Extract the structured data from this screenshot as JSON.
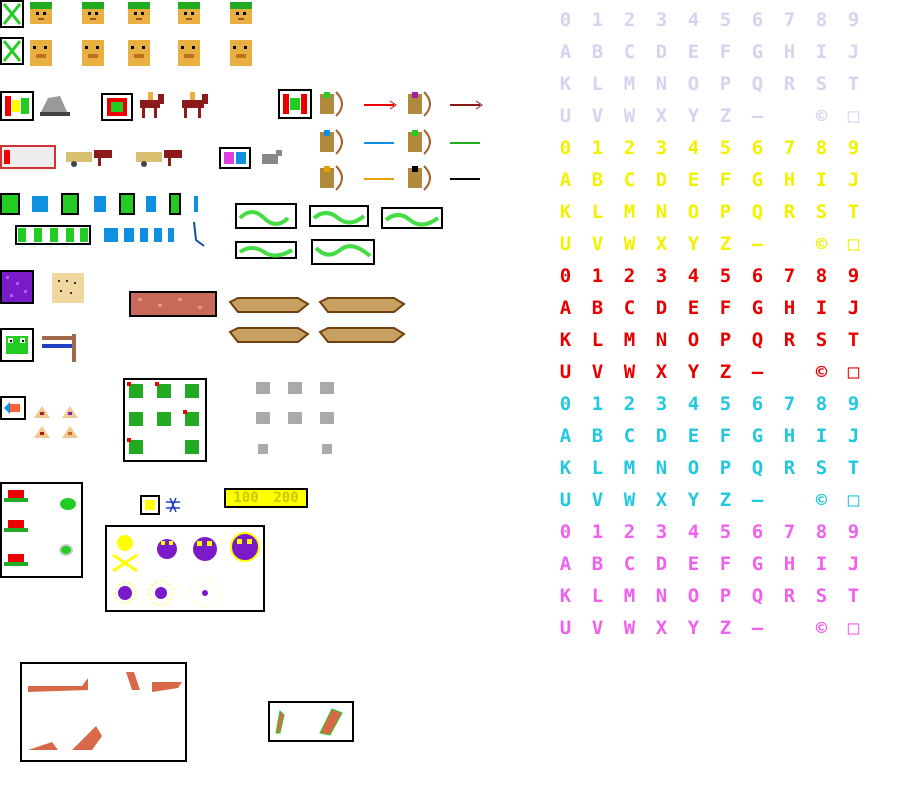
{
  "sheet": {
    "score_labels": [
      "100",
      "200"
    ],
    "score_colors": {
      "fill": "#ffff00",
      "text": "#c8c800"
    }
  },
  "font_table": {
    "rows": [
      [
        "0",
        "1",
        "2",
        "3",
        "4",
        "5",
        "6",
        "7",
        "8",
        "9"
      ],
      [
        "A",
        "B",
        "C",
        "D",
        "E",
        "F",
        "G",
        "H",
        "I",
        "J"
      ],
      [
        "K",
        "L",
        "M",
        "N",
        "O",
        "P",
        "Q",
        "R",
        "S",
        "T"
      ],
      [
        "U",
        "V",
        "W",
        "X",
        "Y",
        "Z",
        "—",
        "",
        "©",
        "□"
      ]
    ],
    "palettes": [
      {
        "name": "lavender",
        "color": "#d4d4f0"
      },
      {
        "name": "yellow",
        "color": "#f2f200"
      },
      {
        "name": "red",
        "color": "#e80000"
      },
      {
        "name": "cyan",
        "color": "#22c8e0"
      },
      {
        "name": "magenta",
        "color": "#f060f0"
      }
    ]
  },
  "colors": {
    "skin": "#e8b040",
    "green": "#22cc22",
    "brown": "#8b1a1a",
    "blue": "#1090e0",
    "purple": "#7a1ac8",
    "tan": "#c88a50",
    "croc": "#d86848",
    "snake": "#44dd44"
  },
  "icons": {
    "face_rows": 2,
    "bullet_names": [
      "arrow-red",
      "arrow-blue",
      "arrow-green",
      "arrow-orange",
      "arrow-black"
    ]
  }
}
